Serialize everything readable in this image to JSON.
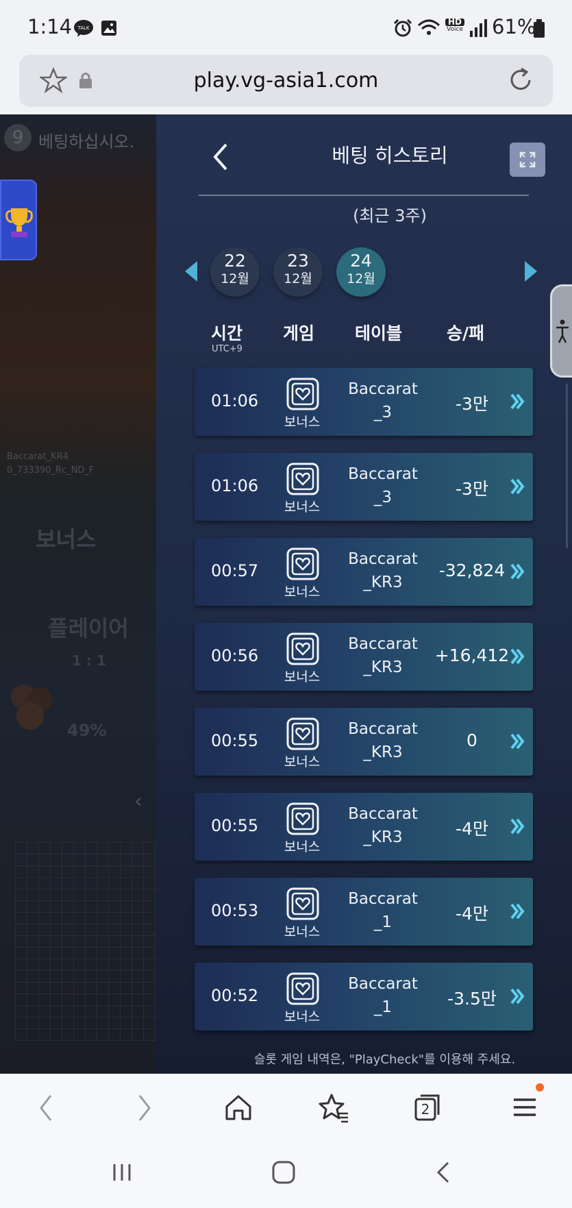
{
  "status_bar": {
    "time": "1:14",
    "battery": "61%",
    "hd_label": "HD",
    "voice_label": "Voice"
  },
  "browser": {
    "url": "play.vg-asia1.com",
    "tabs_count": "2"
  },
  "game_bg": {
    "round_number": "9",
    "instruction": "베팅하십시오.",
    "table_line1": "Baccarat_KR4",
    "table_line2": "0_733390_Rc_ND_F",
    "bet_label": "보너스",
    "player_label": "플레이어",
    "payout": "1 : 1",
    "percent": "49%"
  },
  "panel": {
    "title": "베팅 히스토리",
    "subtitle": "(최근 3주)",
    "dates": [
      {
        "day": "22",
        "month": "12월"
      },
      {
        "day": "23",
        "month": "12월"
      },
      {
        "day": "24",
        "month": "12월"
      }
    ],
    "columns": {
      "time": "시간",
      "timezone": "UTC+9",
      "game": "게임",
      "table": "테이블",
      "result": "승/패"
    },
    "rows": [
      {
        "time": "01:06",
        "game": "보너스",
        "table_top": "Baccarat",
        "table_bottom": "_3",
        "result": "-3만"
      },
      {
        "time": "01:06",
        "game": "보너스",
        "table_top": "Baccarat",
        "table_bottom": "_3",
        "result": "-3만"
      },
      {
        "time": "00:57",
        "game": "보너스",
        "table_top": "Baccarat",
        "table_bottom": "_KR3",
        "result": "-32,824"
      },
      {
        "time": "00:56",
        "game": "보너스",
        "table_top": "Baccarat",
        "table_bottom": "_KR3",
        "result": "+16,412"
      },
      {
        "time": "00:55",
        "game": "보너스",
        "table_top": "Baccarat",
        "table_bottom": "_KR3",
        "result": "0"
      },
      {
        "time": "00:55",
        "game": "보너스",
        "table_top": "Baccarat",
        "table_bottom": "_KR3",
        "result": "-4만"
      },
      {
        "time": "00:53",
        "game": "보너스",
        "table_top": "Baccarat",
        "table_bottom": "_1",
        "result": "-4만"
      },
      {
        "time": "00:52",
        "game": "보너스",
        "table_top": "Baccarat",
        "table_bottom": "_1",
        "result": "-3.5만"
      }
    ],
    "footnote": "슬롯 게임 내역은, \"PlayCheck\"를 이용해 주세요."
  },
  "colors": {
    "panel_bg": "#243150",
    "active_date": "#2b6b7b",
    "accent": "#4fb2d6"
  }
}
